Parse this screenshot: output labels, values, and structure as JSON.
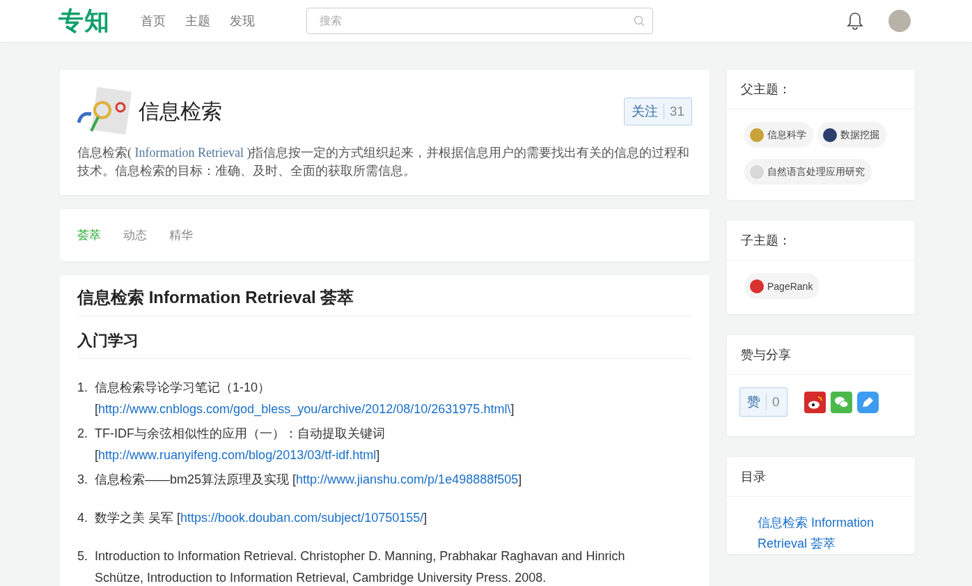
{
  "header": {
    "logo": "专知",
    "nav": [
      "首页",
      "主题",
      "发现"
    ],
    "search": {
      "placeholder": "搜索"
    }
  },
  "topic": {
    "title": "信息检索",
    "follow": {
      "label": "关注",
      "count": "31"
    },
    "desc_before": "信息检索(",
    "desc_term": " Information Retrieval ",
    "desc_after": ")指信息按一定的方式组织起来，并根据信息用户的需要找出有关的信息的过程和技术。信息检索的目标：准确、及时、全面的获取所需信息。"
  },
  "tabs": [
    {
      "label": "荟萃",
      "selected": true
    },
    {
      "label": "动态",
      "selected": false
    },
    {
      "label": "精华",
      "selected": false
    }
  ],
  "article": {
    "title": "信息检索 Information Retrieval 荟萃",
    "section": "入门学习",
    "items": [
      {
        "number": "1.",
        "text": "信息检索导论学习笔记（1-10） [",
        "link": "http://www.cnblogs.com/god_bless_you/archive/2012/08/10/2631975.html\\",
        "after": "]"
      },
      {
        "number": "2.",
        "text": "TF-IDF与余弦相似性的应用（一）：自动提取关键词 [",
        "link": "http://www.ruanyifeng.com/blog/2013/03/tf-idf.html",
        "after": "]"
      },
      {
        "number": "3.",
        "text": "信息检索——bm25算法原理及实现 [",
        "link": "http://www.jianshu.com/p/1e498888f505",
        "after": "]"
      },
      {
        "number": "4.",
        "text": "数学之美 吴军 [",
        "link": "https://book.douban.com/subject/10750155/",
        "after": "]"
      },
      {
        "number": "5.",
        "text": "Introduction to Information Retrieval. Christopher D. Manning, Prabhakar Raghavan and Hinrich Schütze, Introduction to Information Retrieval, Cambridge University Press. 2008."
      }
    ]
  },
  "parent_topics": {
    "title": "父主题：",
    "tags": [
      {
        "label": "信息科学",
        "color": "#c9a23a"
      },
      {
        "label": "数据挖掘",
        "color": "#2c3e6b"
      },
      {
        "label": "自然语言处理应用研究",
        "color": "#d8d8d8"
      }
    ]
  },
  "child_topics": {
    "title": "子主题：",
    "tags": [
      {
        "label": "PageRank",
        "color": "#d93030"
      }
    ]
  },
  "share": {
    "title": "赞与分享",
    "like": {
      "label": "赞",
      "count": "0"
    }
  },
  "toc": {
    "title": "目录",
    "items": [
      "信息检索 Information Retrieval 荟萃"
    ]
  }
}
